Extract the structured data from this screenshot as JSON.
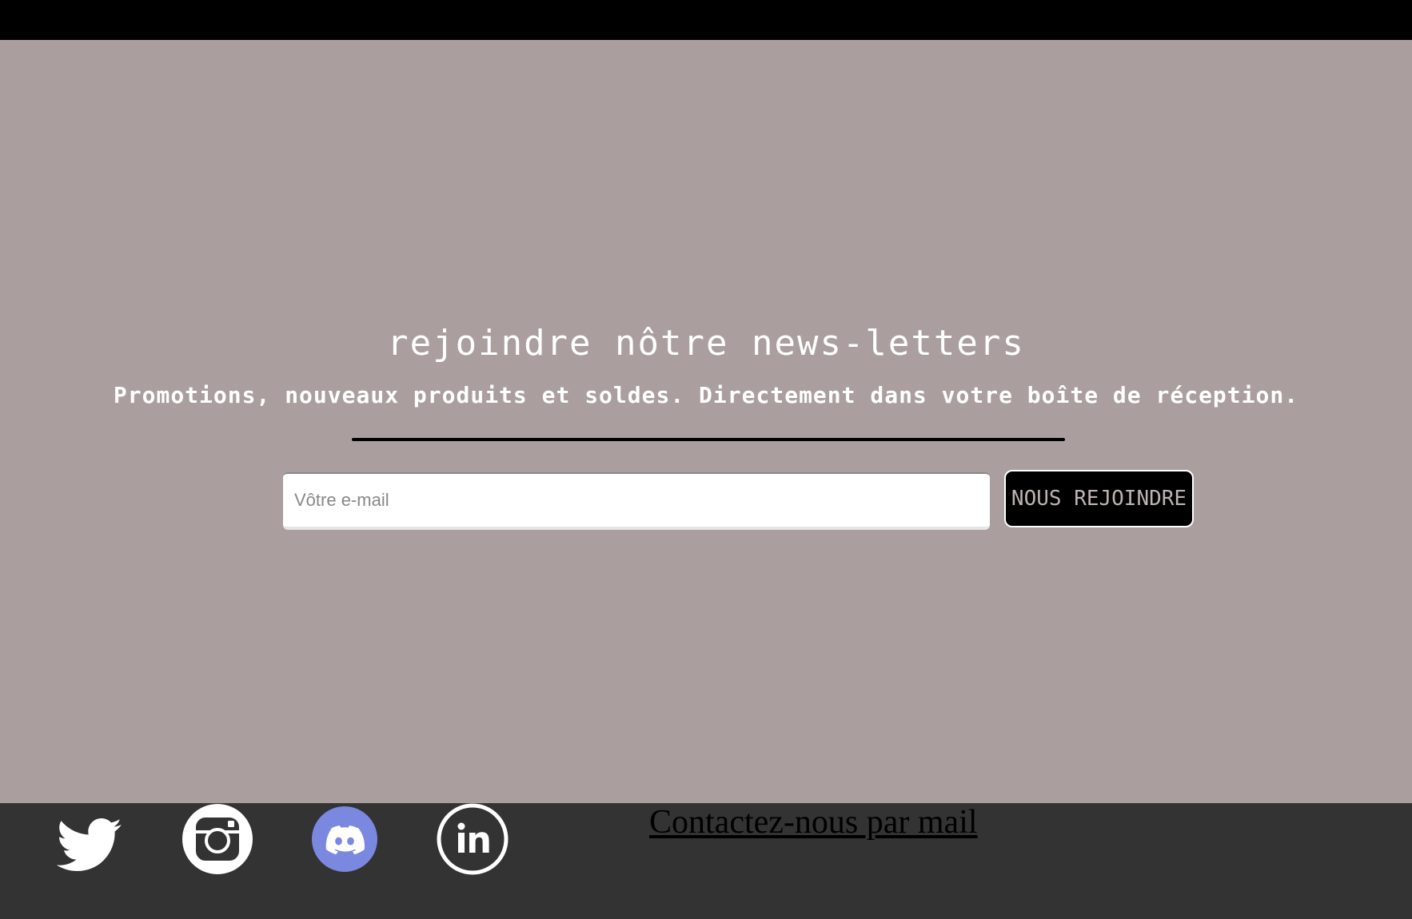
{
  "newsletter": {
    "title": "rejoindre nôtre news-letters",
    "subtitle": "Promotions, nouveaux produits et soldes. Directement dans votre boîte de réception.",
    "email_placeholder": "Vôtre e-mail",
    "email_value": "",
    "join_label": "NOUS REJOINDRE"
  },
  "footer": {
    "social_icons": [
      "twitter-icon",
      "instagram-icon",
      "discord-icon",
      "linkedin-icon"
    ],
    "contact_label": "Contactez-nous par mail"
  },
  "colors": {
    "top_bar": "#000000",
    "background": "#aa9f9e",
    "footer": "#333333",
    "discord": "#7a88e0",
    "button_bg": "#000000",
    "button_text": "#bdb3b2"
  }
}
